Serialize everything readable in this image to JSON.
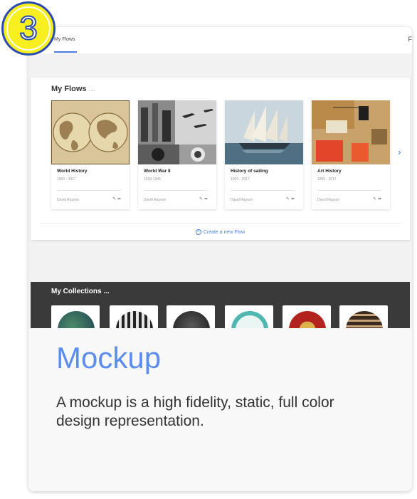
{
  "step_number": "3",
  "app": {
    "tab_label": "My Flows",
    "top_right_label": "F"
  },
  "flows": {
    "title": "My Flows",
    "title_suffix": "...",
    "create_label": "Create a new Flow",
    "items": [
      {
        "name": "World History",
        "years": "1900 - 2017",
        "author": "David Rayson"
      },
      {
        "name": "World War II",
        "years": "1939-1945",
        "author": "David Rayson"
      },
      {
        "name": "History of sailing",
        "years": "1900 - 2017",
        "author": "David Rayson"
      },
      {
        "name": "Art History",
        "years": "1900 - 2017",
        "author": "David Rayson"
      }
    ]
  },
  "collections": {
    "title": "My Collections",
    "title_suffix": "..."
  },
  "caption": {
    "title": "Mockup",
    "description": "A mockup is a high fidelity, static, full color design representation."
  },
  "colors": {
    "accent": "#5b8def",
    "badge_fill": "#f7ef20",
    "badge_ring": "#2c4bb0",
    "collections_band": "#3a3a3a"
  }
}
